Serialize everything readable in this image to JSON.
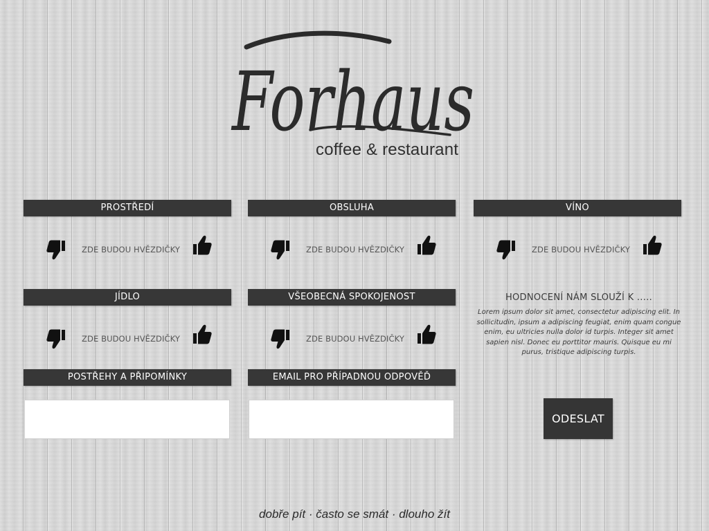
{
  "brand": {
    "logo_text": "Forhaus",
    "subtitle": "coffee & restaurant"
  },
  "ratings": {
    "prostredi": {
      "label": "PROSTŘEDÍ",
      "placeholder": "ZDE BUDOU HVĚZDIČKY"
    },
    "obsluha": {
      "label": "OBSLUHA",
      "placeholder": "ZDE BUDOU HVĚZDIČKY"
    },
    "vino": {
      "label": "VÍNO",
      "placeholder": "ZDE BUDOU HVĚZDIČKY"
    },
    "jidlo": {
      "label": "JÍDLO",
      "placeholder": "ZDE BUDOU HVĚZDIČKY"
    },
    "spokojenost": {
      "label": "VŠEOBECNÁ SPOKOJENOST",
      "placeholder": "ZDE BUDOU HVĚZDIČKY"
    }
  },
  "comments": {
    "label": "POSTŘEHY A PŘIPOMÍNKY",
    "value": ""
  },
  "email": {
    "label": "EMAIL PRO PŘÍPADNOU ODPOVĚĎ",
    "value": ""
  },
  "info": {
    "title": "HODNOCENÍ NÁM SLOUŽÍ K .....",
    "text": "Lorem ipsum dolor sit amet, consectetur adipiscing elit. In sollicitudin, ipsum a adipiscing feugiat, enim quam congue enim, eu ultricies nulla dolor id turpis. Integer sit amet sapien nisl. Donec eu porttitor mauris. Quisque eu mi purus, tristique adipiscing turpis."
  },
  "submit_label": "ODESLAT",
  "footer_motto": "dobře pít · často se smát · dlouho žít",
  "icons": {
    "negative": "thumbs-down-icon",
    "positive": "thumbs-up-icon"
  },
  "colors": {
    "header_bg": "#373737",
    "header_text": "#ffffff",
    "button_bg": "#353535",
    "logo": "#2b2b2b"
  }
}
